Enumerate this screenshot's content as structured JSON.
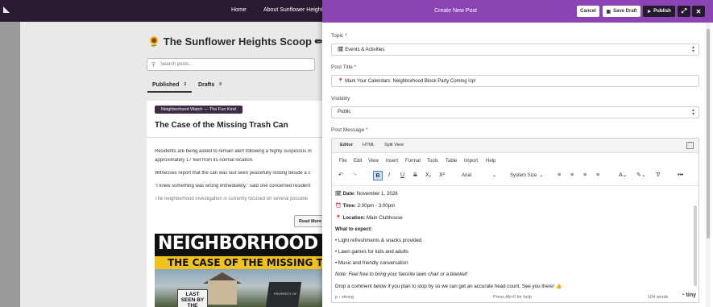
{
  "site": {
    "nav": {
      "home": "Home",
      "about": "About Sunflower Heights"
    },
    "blog_title": "🌻 The Sunflower Heights Scoop ✏",
    "search_placeholder": "Search posts...",
    "tabs": [
      {
        "label": "Published",
        "count": "2"
      },
      {
        "label": "Drafts",
        "count": "0"
      }
    ],
    "post": {
      "tag": "Neighborhood Watch — The Fun Kind",
      "title": "The Case of the Missing Trash Can",
      "paragraphs": [
        "Residents are being asked to remain alert following a highly suspicious m",
        "approximately 17 feet from its normal location.",
        "Witnesses report that the can was last seen peacefully resting beside a c",
        "\"I knew something was wrong immediately,\" said one concerned resident",
        "The neighborhood investigation is currently focused on several possible"
      ],
      "read_more": "Read More",
      "poster": {
        "headline": "NEIGHBORHOOD W",
        "subtitle": "THE CASE OF THE MISSING TRA",
        "sign": "LAST SEEN BY THE DRIVEWAY",
        "bin_label": "PROPERTY OF"
      }
    }
  },
  "drawer": {
    "title": "Create New Post",
    "buttons": {
      "cancel": "Cancel",
      "save_draft": "Save Draft",
      "publish": "Publish"
    },
    "topic": {
      "label": "Topic",
      "value": "🗓 Events & Activities"
    },
    "post_title": {
      "label": "Post Title",
      "value": "📍 Mark Your Calendars: Neighborhood Block Party Coming Up!"
    },
    "visibility": {
      "label": "Visibility",
      "value": "Public"
    },
    "message": {
      "label": "Post Message"
    },
    "editor": {
      "modes": [
        "Editor",
        "HTML",
        "Split View"
      ],
      "menus": [
        "File",
        "Edit",
        "View",
        "Insert",
        "Format",
        "Tools",
        "Table",
        "Import",
        "Help"
      ],
      "font": "Arial",
      "size": "System Size",
      "content": {
        "date_label": "Date:",
        "date_value": " November 1, 2026",
        "time_label": "Time:",
        "time_value": " 2:00pm - 3:00pm",
        "location_label": "Location:",
        "location_value": " Main Clubhouse",
        "expect_heading": "What to expect:",
        "items": [
          "• Light refreshments & snacks provided",
          "• Lawn games for kids and adults",
          "• Music and friendly conversation"
        ],
        "note": "Note: Feel free to bring your favorite lawn chair or a blanket!",
        "closing": "Drop a comment below if you plan to stop by so we can get an accurate head count. See you there! 👍"
      },
      "status": {
        "path": "p › strong",
        "help": "Press Alt+0 for help",
        "words": "104 words",
        "brand": "tiny"
      }
    }
  },
  "colors": {
    "accent": "#8c44b5",
    "header_dark": "#2b1a33",
    "publish": "#231a2b"
  }
}
